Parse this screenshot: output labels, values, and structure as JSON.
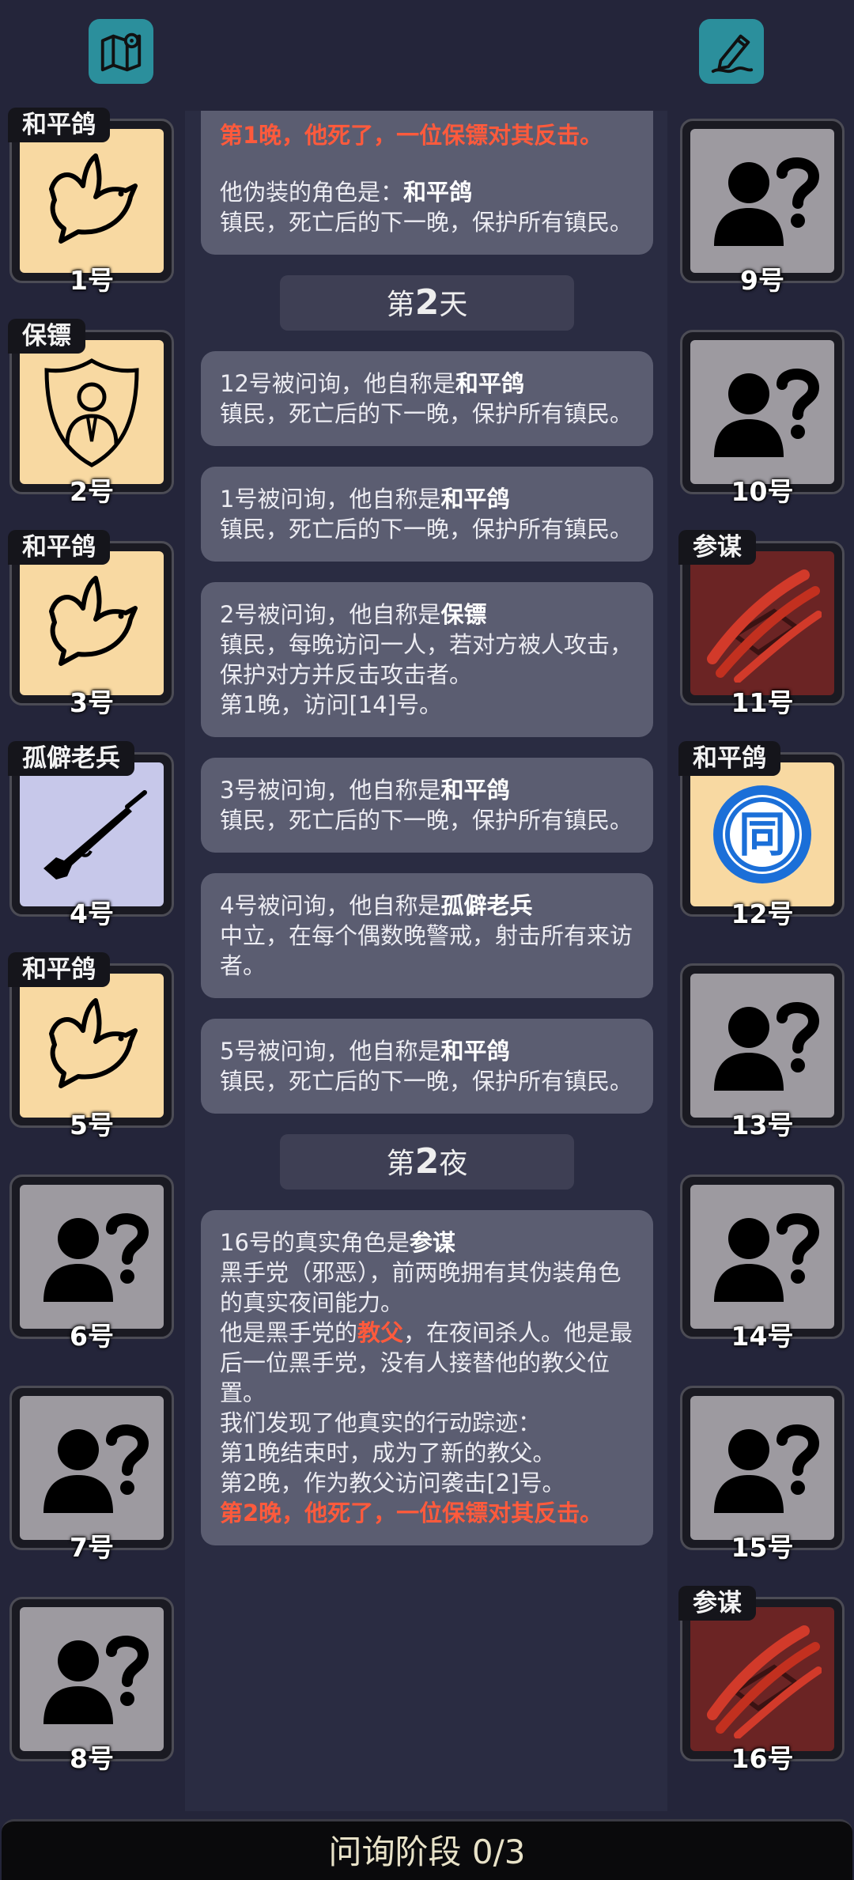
{
  "players_left": [
    {
      "num": "1号",
      "role": "和平鸽",
      "icon": "dove-icon",
      "bg": "town"
    },
    {
      "num": "2号",
      "role": "保镖",
      "icon": "bodyguard-shield-icon",
      "bg": "town"
    },
    {
      "num": "3号",
      "role": "和平鸽",
      "icon": "dove-icon",
      "bg": "town"
    },
    {
      "num": "4号",
      "role": "孤僻老兵",
      "icon": "rifle-icon",
      "bg": "neutral"
    },
    {
      "num": "5号",
      "role": "和平鸽",
      "icon": "dove-icon",
      "bg": "town"
    },
    {
      "num": "6号",
      "role": "",
      "icon": "unknown-person-icon",
      "bg": "unknown"
    },
    {
      "num": "7号",
      "role": "",
      "icon": "unknown-person-icon",
      "bg": "unknown"
    },
    {
      "num": "8号",
      "role": "",
      "icon": "unknown-person-icon",
      "bg": "unknown"
    }
  ],
  "players_right": [
    {
      "num": "9号",
      "role": "",
      "icon": "unknown-person-icon",
      "bg": "unknown"
    },
    {
      "num": "10号",
      "role": "",
      "icon": "unknown-person-icon",
      "bg": "unknown"
    },
    {
      "num": "11号",
      "role": "参谋",
      "icon": "claw-slash-icon",
      "bg": "evil"
    },
    {
      "num": "12号",
      "role": "和平鸽",
      "icon": "same-badge-icon",
      "bg": "town",
      "badge_text": "同"
    },
    {
      "num": "13号",
      "role": "",
      "icon": "unknown-person-icon",
      "bg": "unknown"
    },
    {
      "num": "14号",
      "role": "",
      "icon": "unknown-person-icon",
      "bg": "unknown"
    },
    {
      "num": "15号",
      "role": "",
      "icon": "unknown-person-icon",
      "bg": "unknown"
    },
    {
      "num": "16号",
      "role": "参谋",
      "icon": "claw-slash-icon",
      "bg": "evil"
    }
  ],
  "log": {
    "card0": {
      "death": "第1晚，他死了，一位保镖对其反击。",
      "disguise_prefix": "他伪装的角色是：",
      "disguise_role": "和平鸽",
      "desc": "镇民，死亡后的下一晚，保护所有镇民。"
    },
    "phase_day": {
      "prefix": "第",
      "num": "2",
      "suffix": "天"
    },
    "claims": [
      {
        "prefix": "12号被问询，他自称是",
        "role": "和平鸽",
        "desc": "镇民，死亡后的下一晚，保护所有镇民。",
        "extra": ""
      },
      {
        "prefix": "1号被问询，他自称是",
        "role": "和平鸽",
        "desc": "镇民，死亡后的下一晚，保护所有镇民。",
        "extra": ""
      },
      {
        "prefix": "2号被问询，他自称是",
        "role": "保镖",
        "desc": "镇民，每晚访问一人，若对方被人攻击，保护对方并反击攻击者。",
        "extra": "第1晚，访问[14]号。"
      },
      {
        "prefix": "3号被问询，他自称是",
        "role": "和平鸽",
        "desc": "镇民，死亡后的下一晚，保护所有镇民。",
        "extra": ""
      },
      {
        "prefix": "4号被问询，他自称是",
        "role": "孤僻老兵",
        "desc": "中立，在每个偶数晚警戒，射击所有来访者。",
        "extra": ""
      },
      {
        "prefix": "5号被问询，他自称是",
        "role": "和平鸽",
        "desc": "镇民，死亡后的下一晚，保护所有镇民。",
        "extra": ""
      }
    ],
    "phase_night": {
      "prefix": "第",
      "num": "2",
      "suffix": "夜"
    },
    "reveal": {
      "line1_prefix": "16号的真实角色是",
      "line1_role": "参谋",
      "line2": "黑手党（邪恶），前两晚拥有其伪装角色的真实夜间能力。",
      "line3_a": "他是黑手党的",
      "line3_role": "教父",
      "line3_b": "，在夜间杀人。他是最后一位黑手党，没有人接替他的教父位置。",
      "line4": "我们发现了他真实的行动踪迹：",
      "line5": "第1晚结束时，成为了新的教父。",
      "line6": "第2晚，作为教父访问袭击[2]号。",
      "line7": "第2晚，他死了，一位保镖对其反击。"
    }
  },
  "bottom": {
    "label": "问询阶段 0/3"
  },
  "colors": {
    "town": "#f8d9a2",
    "unknown": "#9d9aa0",
    "evil": "#6b2424",
    "neutral": "#c7c8ea",
    "accent_red": "#ff5a3c",
    "button_teal": "#2b8f9c"
  }
}
